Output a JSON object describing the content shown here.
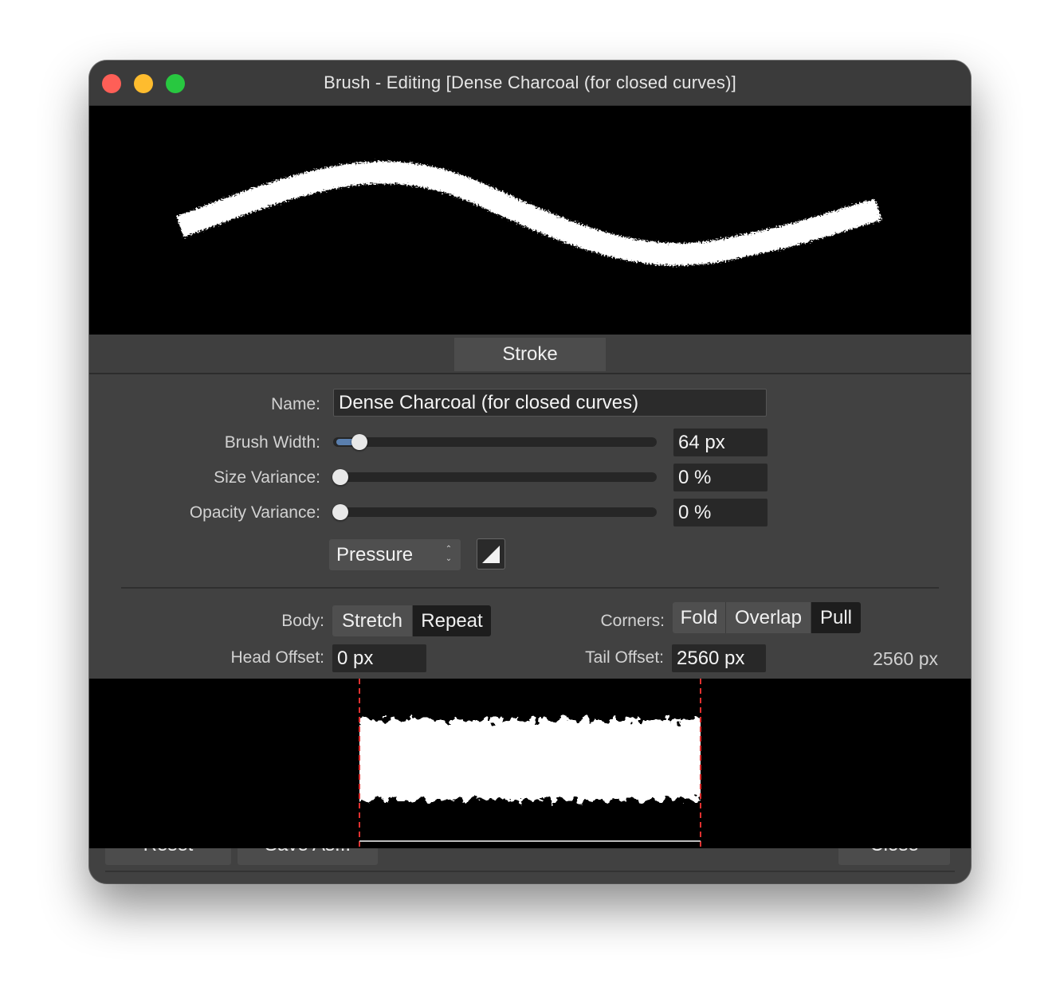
{
  "window": {
    "title": "Brush - Editing [Dense Charcoal (for closed curves)]"
  },
  "tabs": {
    "stroke_label": "Stroke"
  },
  "form": {
    "name_label": "Name:",
    "name_value": "Dense Charcoal (for closed curves)",
    "brush_width_label": "Brush Width:",
    "brush_width_value": "64 px",
    "brush_width_slider_fraction": 0.06,
    "size_variance_label": "Size Variance:",
    "size_variance_value": "0 %",
    "size_variance_slider_fraction": 0.0,
    "opacity_variance_label": "Opacity Variance:",
    "opacity_variance_value": "0 %",
    "opacity_variance_slider_fraction": 0.0,
    "controller_value": "Pressure"
  },
  "nozzle": {
    "body_label": "Body:",
    "body_options": [
      "Stretch",
      "Repeat"
    ],
    "body_selected": "Repeat",
    "corners_label": "Corners:",
    "corners_options": [
      "Fold",
      "Overlap",
      "Pull"
    ],
    "corners_selected": "Pull",
    "head_offset_label": "Head Offset:",
    "head_offset_value": "0 px",
    "tail_offset_label": "Tail Offset:",
    "tail_offset_value": "2560 px",
    "total_length": "2560 px"
  },
  "footer": {
    "reset_label": "Reset",
    "save_as_label": "Save As...",
    "close_label": "Close"
  },
  "colors": {
    "window_bg": "#414141",
    "slider_fill": "#5a7fae",
    "guide_line": "#e0302f"
  },
  "icons": [
    "pressure-curve-icon",
    "select-arrows-icon"
  ]
}
